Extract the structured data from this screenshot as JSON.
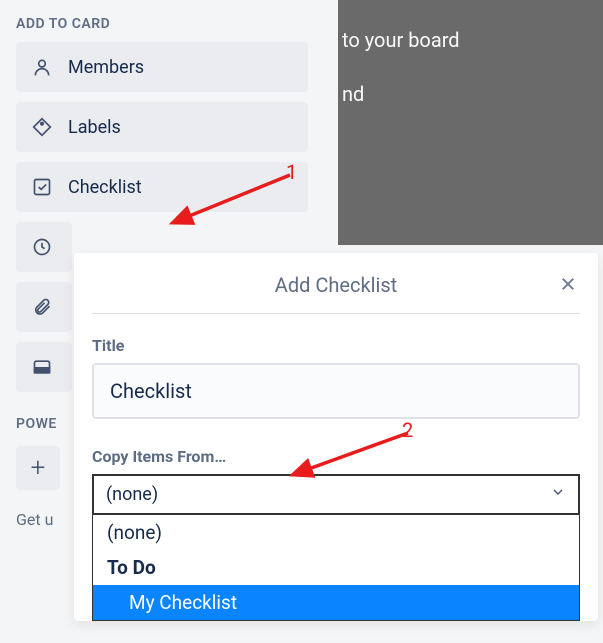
{
  "sidebar": {
    "header": "ADD TO CARD",
    "items": [
      {
        "icon": "person-icon",
        "label": "Members"
      },
      {
        "icon": "tag-icon",
        "label": "Labels"
      },
      {
        "icon": "check-square-icon",
        "label": "Checklist"
      },
      {
        "icon": "clock-icon",
        "label": ""
      },
      {
        "icon": "paperclip-icon",
        "label": ""
      },
      {
        "icon": "cover-icon",
        "label": ""
      }
    ],
    "power_header": "POWE",
    "footer": "Get u"
  },
  "overlay": {
    "line1": "to your board",
    "line2": "nd"
  },
  "popover": {
    "title": "Add Checklist",
    "title_label": "Title",
    "title_value": "Checklist",
    "copy_label": "Copy Items From…",
    "selected": "(none)",
    "options": [
      {
        "label": "(none)",
        "type": "item"
      },
      {
        "label": "To Do",
        "type": "group"
      },
      {
        "label": "My Checklist",
        "type": "selected"
      }
    ]
  },
  "annotations": {
    "n1": "1",
    "n2": "2"
  }
}
